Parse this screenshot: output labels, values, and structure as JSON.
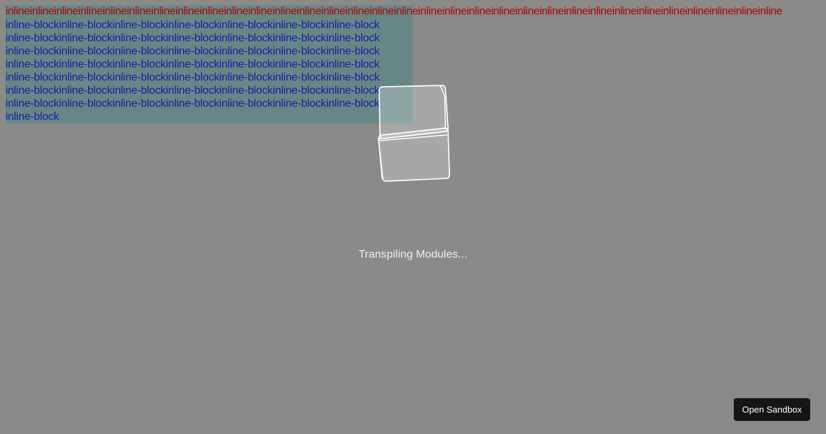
{
  "test_content": {
    "inline_text": "inlineinlineinlineinlineinlineinlineinlineinlineinlineinlineinlineinlineinlineinlineinlineinlineinlineinlineinlineinlineinlineinlineinlineinlineinlineinlineinlineinlineinlineinlineinlineinline",
    "inline_block_lines": [
      "inline-blockinline-blockinline-blockinline-blockinline-blockinline-blockinline-block",
      "inline-blockinline-blockinline-blockinline-blockinline-blockinline-blockinline-block",
      "inline-blockinline-blockinline-blockinline-blockinline-blockinline-blockinline-block",
      "inline-blockinline-blockinline-blockinline-blockinline-blockinline-blockinline-block",
      "inline-blockinline-blockinline-blockinline-blockinline-blockinline-blockinline-block",
      "inline-blockinline-blockinline-blockinline-blockinline-blockinline-blockinline-block",
      "inline-blockinline-blockinline-blockinline-blockinline-blockinline-blockinline-block",
      "inline-block"
    ],
    "colors": {
      "inline_text": "#b00000",
      "inline_block_text": "#1a1aa0",
      "box_tint": "#008080"
    }
  },
  "loader": {
    "icon": "cube-icon",
    "status_text": "Transpiling Modules..."
  },
  "actions": {
    "open_sandbox_label": "Open Sandbox"
  },
  "colors": {
    "background": "#8a8a8a",
    "button_background": "#151515",
    "status_text": "#f1f1f1"
  }
}
